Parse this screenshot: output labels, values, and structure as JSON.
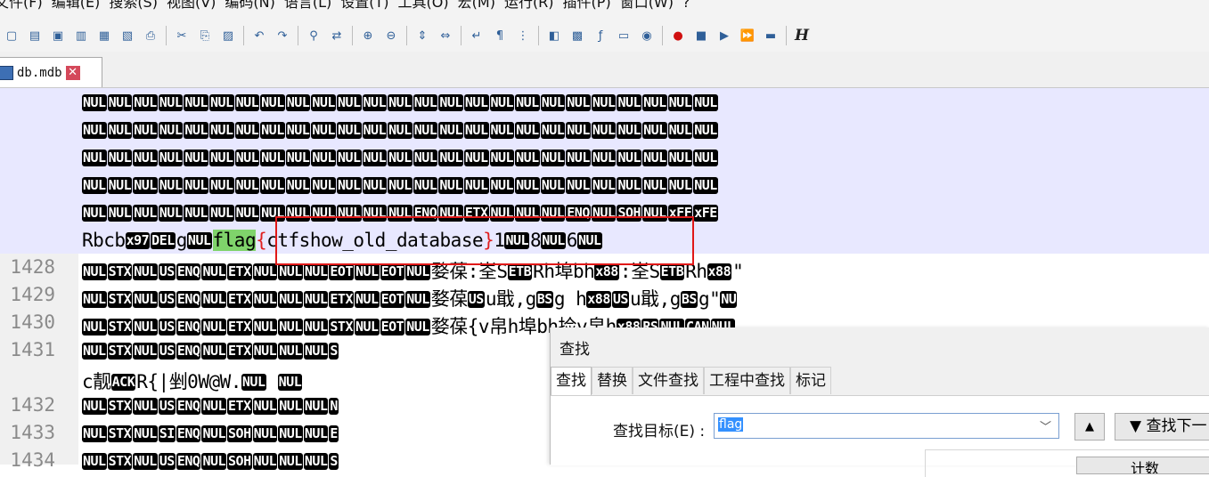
{
  "menu": [
    "文件(F)",
    "编辑(E)",
    "搜索(S)",
    "视图(V)",
    "编码(N)",
    "语言(L)",
    "设置(T)",
    "工具(O)",
    "宏(M)",
    "运行(R)",
    "插件(P)",
    "窗口(W)",
    "?"
  ],
  "toolbar": {
    "icons": [
      "new-file-icon",
      "open-file-icon",
      "save-icon",
      "save-all-icon",
      "close-icon",
      "close-all-icon",
      "print-icon",
      "cut-icon",
      "copy-icon",
      "paste-icon",
      "undo-icon",
      "redo-icon",
      "find-icon",
      "replace-icon",
      "zoom-in-icon",
      "zoom-out-icon",
      "sync-vertical-icon",
      "sync-horizontal-icon",
      "word-wrap-icon",
      "show-all-chars-icon",
      "indent-guide-icon",
      "user-lang-icon",
      "doc-map-icon",
      "function-list-icon",
      "folder-workspace-icon",
      "monitoring-icon",
      "record-macro-icon",
      "stop-macro-icon",
      "play-macro-icon",
      "run-macro-multiple-icon",
      "save-macro-icon"
    ],
    "last_glyph": "H"
  },
  "tab": {
    "label": "db.mdb",
    "close_symbol": "✕"
  },
  "editor": {
    "rows": [
      {
        "num": "",
        "highlight": true,
        "tokens": [
          {
            "c": "NUL"
          },
          {
            "c": "NUL"
          },
          {
            "c": "NUL"
          },
          {
            "c": "NUL"
          },
          {
            "c": "NUL"
          },
          {
            "c": "NUL"
          },
          {
            "c": "NUL"
          },
          {
            "c": "NUL"
          },
          {
            "c": "NUL"
          },
          {
            "c": "NUL"
          },
          {
            "c": "NUL"
          },
          {
            "c": "NUL"
          },
          {
            "c": "NUL"
          },
          {
            "c": "NUL"
          },
          {
            "c": "NUL"
          },
          {
            "c": "NUL"
          },
          {
            "c": "NUL"
          },
          {
            "c": "NUL"
          },
          {
            "c": "NUL"
          },
          {
            "c": "NUL"
          },
          {
            "c": "NUL"
          },
          {
            "c": "NUL"
          },
          {
            "c": "NUL"
          },
          {
            "c": "NUL"
          },
          {
            "c": "NUL"
          }
        ]
      },
      {
        "num": "",
        "highlight": true,
        "tokens": [
          {
            "c": "NUL"
          },
          {
            "c": "NUL"
          },
          {
            "c": "NUL"
          },
          {
            "c": "NUL"
          },
          {
            "c": "NUL"
          },
          {
            "c": "NUL"
          },
          {
            "c": "NUL"
          },
          {
            "c": "NUL"
          },
          {
            "c": "NUL"
          },
          {
            "c": "NUL"
          },
          {
            "c": "NUL"
          },
          {
            "c": "NUL"
          },
          {
            "c": "NUL"
          },
          {
            "c": "NUL"
          },
          {
            "c": "NUL"
          },
          {
            "c": "NUL"
          },
          {
            "c": "NUL"
          },
          {
            "c": "NUL"
          },
          {
            "c": "NUL"
          },
          {
            "c": "NUL"
          },
          {
            "c": "NUL"
          },
          {
            "c": "NUL"
          },
          {
            "c": "NUL"
          },
          {
            "c": "NUL"
          },
          {
            "c": "NUL"
          }
        ]
      },
      {
        "num": "",
        "highlight": true,
        "tokens": [
          {
            "c": "NUL"
          },
          {
            "c": "NUL"
          },
          {
            "c": "NUL"
          },
          {
            "c": "NUL"
          },
          {
            "c": "NUL"
          },
          {
            "c": "NUL"
          },
          {
            "c": "NUL"
          },
          {
            "c": "NUL"
          },
          {
            "c": "NUL"
          },
          {
            "c": "NUL"
          },
          {
            "c": "NUL"
          },
          {
            "c": "NUL"
          },
          {
            "c": "NUL"
          },
          {
            "c": "NUL"
          },
          {
            "c": "NUL"
          },
          {
            "c": "NUL"
          },
          {
            "c": "NUL"
          },
          {
            "c": "NUL"
          },
          {
            "c": "NUL"
          },
          {
            "c": "NUL"
          },
          {
            "c": "NUL"
          },
          {
            "c": "NUL"
          },
          {
            "c": "NUL"
          },
          {
            "c": "NUL"
          },
          {
            "c": "NUL"
          }
        ]
      },
      {
        "num": "",
        "highlight": true,
        "tokens": [
          {
            "c": "NUL"
          },
          {
            "c": "NUL"
          },
          {
            "c": "NUL"
          },
          {
            "c": "NUL"
          },
          {
            "c": "NUL"
          },
          {
            "c": "NUL"
          },
          {
            "c": "NUL"
          },
          {
            "c": "NUL"
          },
          {
            "c": "NUL"
          },
          {
            "c": "NUL"
          },
          {
            "c": "NUL"
          },
          {
            "c": "NUL"
          },
          {
            "c": "NUL"
          },
          {
            "c": "NUL"
          },
          {
            "c": "NUL"
          },
          {
            "c": "NUL"
          },
          {
            "c": "NUL"
          },
          {
            "c": "NUL"
          },
          {
            "c": "NUL"
          },
          {
            "c": "NUL"
          },
          {
            "c": "NUL"
          },
          {
            "c": "NUL"
          },
          {
            "c": "NUL"
          },
          {
            "c": "NUL"
          },
          {
            "c": "NUL"
          }
        ]
      },
      {
        "num": "",
        "highlight": true,
        "tokens": [
          {
            "c": "NUL"
          },
          {
            "c": "NUL"
          },
          {
            "c": "NUL"
          },
          {
            "c": "NUL"
          },
          {
            "c": "NUL"
          },
          {
            "c": "NUL"
          },
          {
            "c": "NUL"
          },
          {
            "c": "NUL"
          },
          {
            "c": "NUL"
          },
          {
            "c": "NUL"
          },
          {
            "c": "NUL"
          },
          {
            "c": "NUL"
          },
          {
            "c": "NUL"
          },
          {
            "c": "ENQ"
          },
          {
            "c": "NUL"
          },
          {
            "c": "ETX"
          },
          {
            "c": "NUL"
          },
          {
            "c": "NUL"
          },
          {
            "c": "NUL"
          },
          {
            "c": "ENQ"
          },
          {
            "c": "NUL"
          },
          {
            "c": "SOH"
          },
          {
            "c": "NUL"
          },
          {
            "c": "xFF"
          },
          {
            "c": "xFE"
          }
        ]
      },
      {
        "num": "",
        "highlight": true,
        "tokens": [
          {
            "t": "Rbcb"
          },
          {
            "c": "x97"
          },
          {
            "c": "DEL"
          },
          {
            "t": "g"
          },
          {
            "c": "NUL"
          },
          {
            "t": "flag",
            "cls": "flag-word"
          },
          {
            "t": "{",
            "cls": "brace"
          },
          {
            "t": "ctfshow_old_database"
          },
          {
            "t": "}",
            "cls": "brace"
          },
          {
            "t": "1"
          },
          {
            "c": "NUL"
          },
          {
            "t": "8"
          },
          {
            "c": "NUL"
          },
          {
            "t": "6"
          },
          {
            "c": "NUL"
          }
        ]
      },
      {
        "num": "1428",
        "highlight": false,
        "tokens": [
          {
            "c": "NUL"
          },
          {
            "c": "STX"
          },
          {
            "c": "NUL"
          },
          {
            "c": "US"
          },
          {
            "c": "ENQ"
          },
          {
            "c": "NUL"
          },
          {
            "c": "ETX"
          },
          {
            "c": "NUL"
          },
          {
            "c": "NUL"
          },
          {
            "c": "NUL"
          },
          {
            "c": "EOT"
          },
          {
            "c": "NUL"
          },
          {
            "c": "EOT"
          },
          {
            "c": "NUL"
          },
          {
            "t": "婺葆:峑S"
          },
          {
            "c": "ETB"
          },
          {
            "t": "Rh埠bh"
          },
          {
            "c": "x88"
          },
          {
            "t": ":峑S"
          },
          {
            "c": "ETB"
          },
          {
            "t": "Rh"
          },
          {
            "c": "x88"
          },
          {
            "t": "\""
          }
        ]
      },
      {
        "num": "1429",
        "highlight": false,
        "tokens": [
          {
            "c": "NUL"
          },
          {
            "c": "STX"
          },
          {
            "c": "NUL"
          },
          {
            "c": "US"
          },
          {
            "c": "ENQ"
          },
          {
            "c": "NUL"
          },
          {
            "c": "ETX"
          },
          {
            "c": "NUL"
          },
          {
            "c": "NUL"
          },
          {
            "c": "NUL"
          },
          {
            "c": "ETX"
          },
          {
            "c": "NUL"
          },
          {
            "c": "EOT"
          },
          {
            "c": "NUL"
          },
          {
            "t": "婺葆"
          },
          {
            "c": "US"
          },
          {
            "t": "u戢,g"
          },
          {
            "c": "BS"
          },
          {
            "t": "g  h"
          },
          {
            "c": "x88"
          },
          {
            "c": "US"
          },
          {
            "t": "u戢,g"
          },
          {
            "c": "BS"
          },
          {
            "t": "g\""
          },
          {
            "c": "NU"
          }
        ]
      },
      {
        "num": "1430",
        "highlight": false,
        "tokens": [
          {
            "c": "NUL"
          },
          {
            "c": "STX"
          },
          {
            "c": "NUL"
          },
          {
            "c": "US"
          },
          {
            "c": "ENQ"
          },
          {
            "c": "NUL"
          },
          {
            "c": "ETX"
          },
          {
            "c": "NUL"
          },
          {
            "c": "NUL"
          },
          {
            "c": "NUL"
          },
          {
            "c": "STX"
          },
          {
            "c": "NUL"
          },
          {
            "c": "EOT"
          },
          {
            "c": "NUL"
          },
          {
            "t": "婺葆{v帛h埠bh捡v帛h"
          },
          {
            "c": "x88"
          },
          {
            "c": "RS"
          },
          {
            "c": "NUL"
          },
          {
            "c": "CAN"
          },
          {
            "c": "NUL"
          }
        ]
      },
      {
        "num": "1431",
        "highlight": false,
        "tokens": [
          {
            "c": "NUL"
          },
          {
            "c": "STX"
          },
          {
            "c": "NUL"
          },
          {
            "c": "US"
          },
          {
            "c": "ENQ"
          },
          {
            "c": "NUL"
          },
          {
            "c": "ETX"
          },
          {
            "c": "NUL"
          },
          {
            "c": "NUL"
          },
          {
            "c": "NUL"
          },
          {
            "c": "S"
          }
        ]
      },
      {
        "num": "",
        "highlight": false,
        "tokens": [
          {
            "t": "c靓"
          },
          {
            "c": "ACK"
          },
          {
            "t": "R{|剉0W@W."
          },
          {
            "c": "NUL"
          },
          {
            "t": "  "
          },
          {
            "c": "NUL"
          }
        ]
      },
      {
        "num": "1432",
        "highlight": false,
        "tokens": [
          {
            "c": "NUL"
          },
          {
            "c": "STX"
          },
          {
            "c": "NUL"
          },
          {
            "c": "US"
          },
          {
            "c": "ENQ"
          },
          {
            "c": "NUL"
          },
          {
            "c": "ETX"
          },
          {
            "c": "NUL"
          },
          {
            "c": "NUL"
          },
          {
            "c": "NUL"
          },
          {
            "c": "N"
          }
        ]
      },
      {
        "num": "1433",
        "highlight": false,
        "tokens": [
          {
            "c": "NUL"
          },
          {
            "c": "STX"
          },
          {
            "c": "NUL"
          },
          {
            "c": "SI"
          },
          {
            "c": "ENQ"
          },
          {
            "c": "NUL"
          },
          {
            "c": "SOH"
          },
          {
            "c": "NUL"
          },
          {
            "c": "NUL"
          },
          {
            "c": "NUL"
          },
          {
            "c": "E"
          }
        ]
      },
      {
        "num": "1434",
        "highlight": false,
        "tokens": [
          {
            "c": "NUL"
          },
          {
            "c": "STX"
          },
          {
            "c": "NUL"
          },
          {
            "c": "US"
          },
          {
            "c": "ENQ"
          },
          {
            "c": "NUL"
          },
          {
            "c": "SOH"
          },
          {
            "c": "NUL"
          },
          {
            "c": "NUL"
          },
          {
            "c": "NUL"
          },
          {
            "c": "S"
          }
        ]
      }
    ]
  },
  "find_dialog": {
    "title": "查找",
    "tabs": [
      "查找",
      "替换",
      "文件查找",
      "工程中查找",
      "标记"
    ],
    "active_tab": 0,
    "target_label": "查找目标(E) :",
    "target_value": "flag",
    "up_button": "▲",
    "find_next_button": "▼ 查找下一",
    "count_button": "计数"
  },
  "colors": {
    "highlight_line": "#e8e8ff",
    "match": "#7fd36b",
    "annotation_box": "#e01818"
  }
}
